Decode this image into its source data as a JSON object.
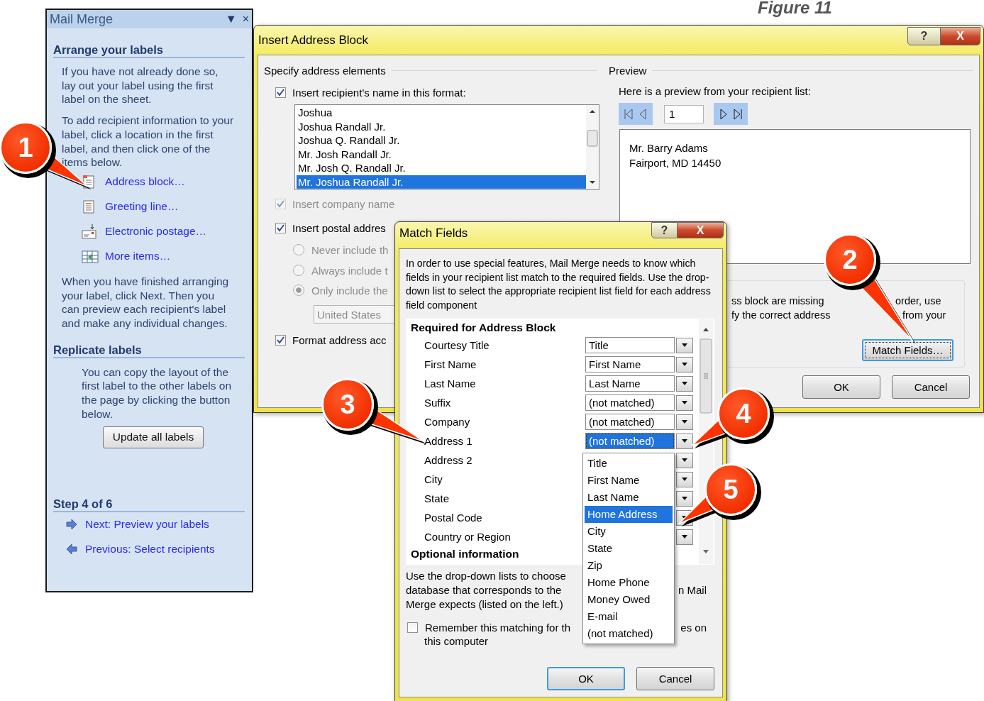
{
  "figure_caption": "Figure 11",
  "task_pane": {
    "title": "Mail Merge",
    "title_controls": [
      "▼",
      "×"
    ],
    "arrange": {
      "heading": "Arrange your labels",
      "paragraphs": [
        "If you have not already done so, lay out your label using the first label on the sheet.",
        "To add recipient information to your label, click a location in the first label, and then click one of the items below."
      ],
      "items": [
        {
          "label": "Address block…",
          "kind": "address"
        },
        {
          "label": "Greeting line…",
          "kind": "greeting"
        },
        {
          "label": "Electronic postage…",
          "kind": "postage"
        },
        {
          "label": "More items…",
          "kind": "more"
        }
      ],
      "closing": "When you have finished arranging your label, click Next. Then you can preview each recipient's label and make any individual changes."
    },
    "replicate": {
      "heading": "Replicate labels",
      "paragraph": "You can copy the layout of the first label to the other labels on the page by clicking the button below.",
      "button": "Update all labels"
    },
    "step": {
      "heading": "Step 4 of 6",
      "links": [
        {
          "label": "Next: Preview your labels",
          "kind": "next"
        },
        {
          "label": "Previous: Select recipients",
          "kind": "previous"
        }
      ]
    }
  },
  "insert_address_block": {
    "title": "Insert Address Block",
    "title_buttons": [
      "?",
      "X"
    ],
    "specify": {
      "heading": "Specify address elements",
      "name_format": {
        "label": "Insert recipient's name in this format:",
        "checked": true
      },
      "formats": [
        {
          "text": "Joshua",
          "selected": false
        },
        {
          "text": "Joshua Randall Jr.",
          "selected": false
        },
        {
          "text": "Joshua Q. Randall Jr.",
          "selected": false
        },
        {
          "text": "Mr. Josh Randall Jr.",
          "selected": false
        },
        {
          "text": "Mr. Josh Q. Randall Jr.",
          "selected": false
        },
        {
          "text": "Mr. Joshua Randall Jr.",
          "selected": true
        }
      ],
      "company": {
        "label": "Insert company name",
        "checked": true,
        "disabled": true
      },
      "postal": {
        "label": "Insert postal addres",
        "checked": true
      },
      "options_disabled": true,
      "country_options": [
        {
          "label": "Never include th",
          "selected": false
        },
        {
          "label": "Always include t",
          "selected": false
        },
        {
          "label": "Only include the",
          "selected": true
        }
      ],
      "country": "United States",
      "format": {
        "label": "Format address acc",
        "checked": true
      }
    },
    "preview": {
      "heading": "Preview",
      "prompt": "Here is a preview from your recipient list:",
      "record": "1",
      "lines": [
        "Mr. Barry Adams",
        "Fairport, MD 14450"
      ]
    },
    "problems": {
      "lines": [
        {
          "left": "ss block are missing",
          "right": "order, use"
        },
        {
          "left": "fy the correct address",
          "right": "from your"
        }
      ],
      "button": "Match Fields…"
    },
    "buttons": [
      "OK",
      "Cancel"
    ]
  },
  "match_fields": {
    "title": "Match Fields",
    "title_buttons": [
      "?",
      "X"
    ],
    "intro": "In order to use special features, Mail Merge needs to know which fields in your recipient list match to the required fields. Use the drop-down list to select the appropriate recipient list field for each address field component",
    "required_heading": "Required for Address Block",
    "rows": [
      {
        "label": "Courtesy Title",
        "value": "Title",
        "focused": false
      },
      {
        "label": "First Name",
        "value": "First Name",
        "focused": false
      },
      {
        "label": "Last Name",
        "value": "Last Name",
        "focused": false
      },
      {
        "label": "Suffix",
        "value": "(not matched)",
        "focused": false
      },
      {
        "label": "Company",
        "value": "(not matched)",
        "focused": false
      },
      {
        "label": "Address 1",
        "value": "(not matched)",
        "focused": true
      },
      {
        "label": "Address 2"
      },
      {
        "label": "City"
      },
      {
        "label": "State"
      },
      {
        "label": "Postal Code"
      },
      {
        "label": "Country or Region"
      }
    ],
    "optional_heading": "Optional information",
    "optional_lines": [
      {
        "left": "Use the drop-down lists to choose"
      },
      {
        "left": "database that corresponds to the",
        "right": "n Mail"
      },
      {
        "left": "Merge expects (listed on the left.)"
      }
    ],
    "remember": {
      "label": "Remember this matching for th",
      "tail": "es on",
      "line2": "this computer",
      "checked": false
    },
    "buttons": [
      "OK",
      "Cancel"
    ],
    "dropdown": [
      {
        "label": "Title",
        "selected": false
      },
      {
        "label": "First Name",
        "selected": false
      },
      {
        "label": "Last Name",
        "selected": false
      },
      {
        "label": "Home Address",
        "selected": true
      },
      {
        "label": "City",
        "selected": false
      },
      {
        "label": "State",
        "selected": false
      },
      {
        "label": "Zip",
        "selected": false
      },
      {
        "label": "Home Phone",
        "selected": false
      },
      {
        "label": "Money Owed",
        "selected": false
      },
      {
        "label": "E-mail",
        "selected": false
      },
      {
        "label": "(not matched)",
        "selected": false
      }
    ]
  },
  "callouts": [
    "1",
    "2",
    "3",
    "4",
    "5"
  ]
}
